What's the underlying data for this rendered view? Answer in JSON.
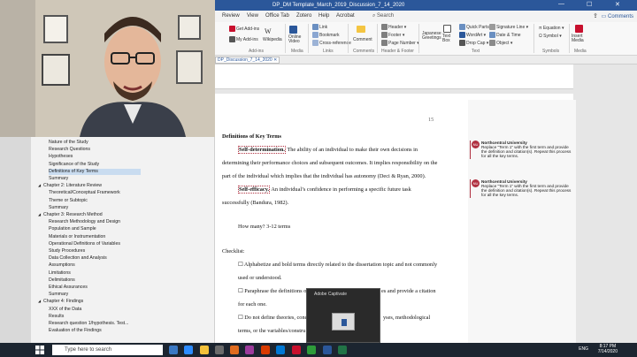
{
  "window": {
    "title": "DP_DM Template_March_2019_Discussion_7_14_2020",
    "min": "—",
    "max": "☐",
    "close": "✕"
  },
  "ribbon_tabs": [
    "Review",
    "View",
    "Office Tab",
    "Zotero",
    "Help",
    "Acrobat"
  ],
  "search_label": "Search",
  "share_label": "⇪",
  "comments_label": "Comments",
  "ribbon": {
    "addins": [
      "Get Add-ins",
      "My Add-ins"
    ],
    "wikipedia": "Wikipedia",
    "online_video": "Online Video",
    "links": [
      "Link",
      "Bookmark",
      "Cross-reference"
    ],
    "comment": "Comment",
    "header_footer": [
      "Header",
      "Footer",
      "Page Number"
    ],
    "japanese": "Japanese Greetings",
    "text_box": "Text Box",
    "text_items": [
      "Quick Parts",
      "WordArt",
      "Drop Cap"
    ],
    "sig": [
      "Signature Line",
      "Date & Time",
      "Object"
    ],
    "symbols": [
      "Equation",
      "Symbol"
    ],
    "insert_media": "Insert Media",
    "group_labels": [
      "Add-ins",
      "Media",
      "Links",
      "Comments",
      "Header & Footer",
      "Text",
      "Symbols",
      "Media"
    ]
  },
  "doc_tab": "DP_Discussion_7_14_2020",
  "nav": {
    "items": [
      "Nature of the Study",
      "Research Questions",
      "Hypotheses",
      "Significance of the Study",
      "Definitions of Key Terms",
      "Summary",
      "Chapter 2: Literature Review",
      "Theoretical/Conceptual Framework",
      "Theme or Subtopic",
      "Summary",
      "Chapter 3: Research Method",
      "Research Methodology and Design",
      "Population and Sample",
      "Materials or Instrumentation",
      "Operational Definitions of Variables",
      "Study Procedures",
      "Data Collection and Analysis",
      "Assumptions",
      "Limitations",
      "Delimitations",
      "Ethical Assurances",
      "Summary",
      "Chapter 4: Findings",
      "XXX of the Data",
      "Results",
      "Research question 1/hypothesis. Test...",
      "Evaluation of the Findings"
    ],
    "selected": "Definitions of Key Terms"
  },
  "doc": {
    "page_number": "15",
    "heading": "Definitions of Key Terms",
    "term1": "Self-determination.",
    "term1_text": " The ability of an individual to make their own decisions in",
    "line2": "determining their performance choices and subsequent outcomes. It implies responsibility on the",
    "line3": "part of the individual which implies that the individual has autonomy (Deci & Ryan, 2000).",
    "term2": "Self-efficacy.",
    "term2_text": " An individual’s confidence in performing a specific future task",
    "line5": "successfully (Bandura, 1982).",
    "how_many": "How many? 3-12 terms",
    "checklist": "Checklist:",
    "check1a": "☐ Alphabetize and bold terms directly related to the dissertation topic and not commonly",
    "check1b": "used or understood.",
    "check2a": "☐ Paraphrase the definitions o",
    "check2b": "es and provide a citation",
    "check2c": "for each one.",
    "check3a": "☐ Do not define theories, conc",
    "check3b": "yses, methodological",
    "check3c": "terms, or the variables/constru"
  },
  "comments": [
    {
      "author": "Northcentral University",
      "body": "Replace “Term 1” with the first term and provide the definition and citation(s). Repeat this process for all the key terms."
    },
    {
      "author": "Northcentral University",
      "body": "Replace “Term 1” with the first term and provide the definition and citation(s). Repeat this process for all the key terms."
    }
  ],
  "captivate": {
    "title": "Adobe Captivate"
  },
  "taskbar": {
    "search_placeholder": "Type here to search",
    "lang": "ENG",
    "time": "8:17 PM",
    "date": "7/14/2020"
  },
  "colors": {
    "word_blue": "#2b579a",
    "comment_red": "#b03040",
    "taskbar": "#1c2530"
  }
}
